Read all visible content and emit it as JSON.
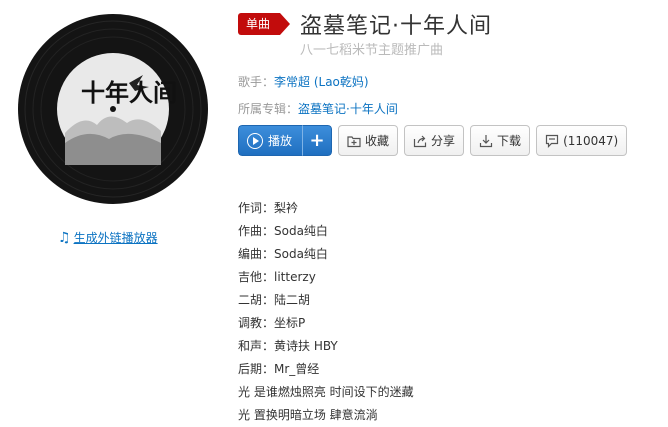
{
  "song": {
    "badge": "单曲",
    "title": "盗墓笔记·十年人间",
    "subtitle": "八一七稻米节主题推广曲",
    "singer_label": "歌手：",
    "singer_name": "李常超 (Lao乾妈)",
    "album_label": "所属专辑：",
    "album_name": "盗墓笔记·十年人间"
  },
  "cover": {
    "art_text": "十年人间"
  },
  "buttons": {
    "play": "播放",
    "add": "+",
    "collect": "收藏",
    "share": "分享",
    "download": "下载",
    "comment": "(110047)"
  },
  "ext_link": {
    "icon": "music-note-icon",
    "label": "生成外链播放器"
  },
  "lyrics": [
    "作词：梨衿",
    "作曲：Soda纯白",
    "编曲：Soda纯白",
    "吉他：litterzy",
    "二胡：陆二胡",
    "调教：坐标P",
    "和声：黄诗扶 HBY",
    "后期：Mr_曾经",
    "光 是谁燃烛照亮 时间设下的迷藏",
    "光 置换明暗立场 肆意流淌"
  ],
  "colors": {
    "accent_red": "#c20c0c",
    "link_blue": "#0c73c2",
    "play_blue": "#2b7fd2"
  }
}
